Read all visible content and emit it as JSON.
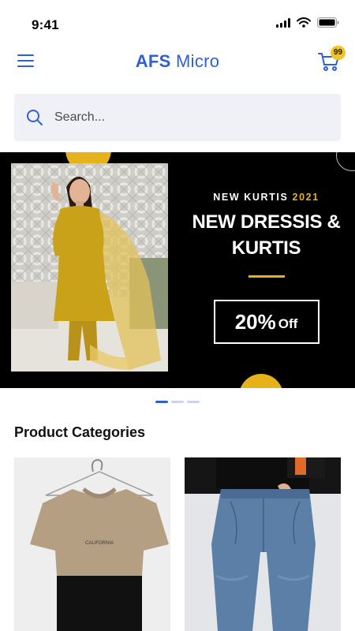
{
  "status_bar": {
    "time": "9:41"
  },
  "header": {
    "brand_bold": "AFS",
    "brand_light": "Micro",
    "cart_count": "99"
  },
  "search": {
    "placeholder": "Search..."
  },
  "banner": {
    "kicker": "NEW KURTIS",
    "kicker_year": "2021",
    "title_line1": "NEW DRESSIS &",
    "title_line2": "KURTIS",
    "offer_value": "20%",
    "offer_suffix": "Off",
    "slides_total": 3,
    "active_slide": 1
  },
  "categories": {
    "title": "Product Categories",
    "items": [
      {
        "name": "t-shirt",
        "print": "CALIFORNIA"
      },
      {
        "name": "jeans"
      }
    ]
  },
  "colors": {
    "brand": "#2f5fd8",
    "accent": "#e5b21a",
    "badge": "#f4c420",
    "search_bg": "#eff1f7"
  },
  "icons": [
    "menu-icon",
    "cart-icon",
    "search-icon",
    "signal-icon",
    "wifi-icon",
    "battery-icon"
  ]
}
